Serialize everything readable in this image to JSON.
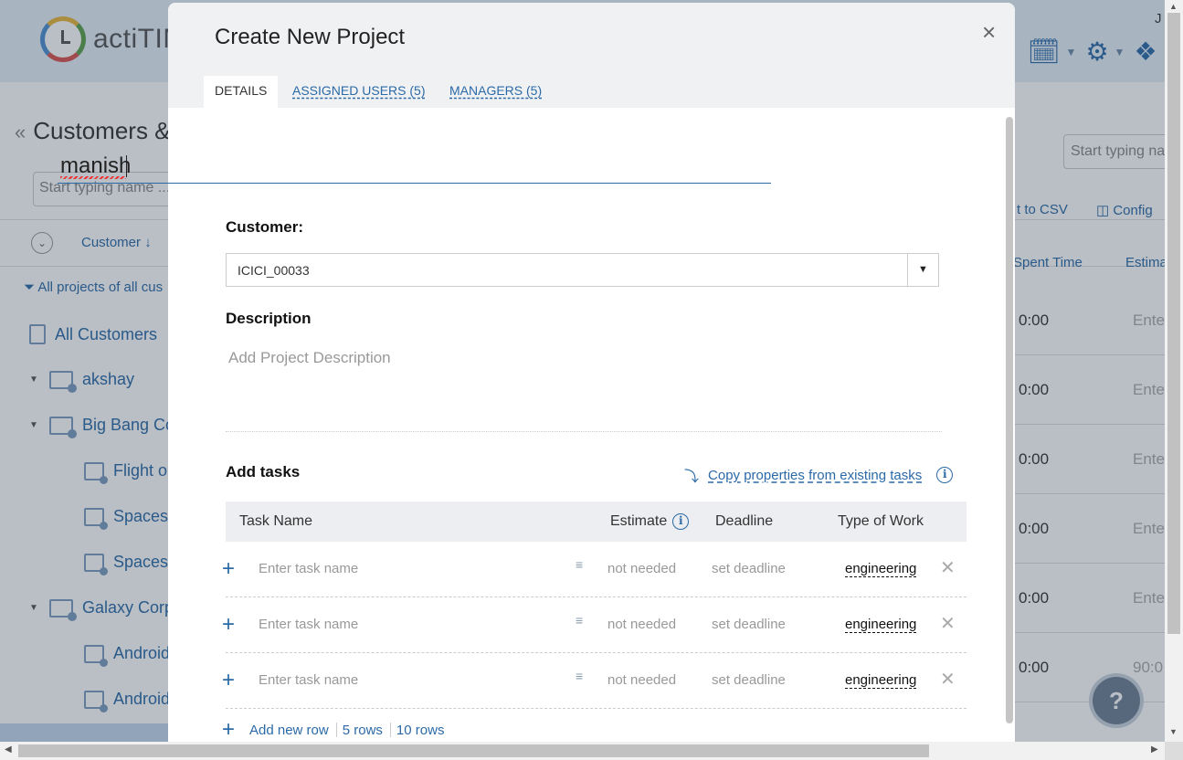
{
  "background": {
    "app_name": "actiTIM",
    "user_initial": "J",
    "page_title": "Customers &",
    "left_search_placeholder": "Start typing name ...",
    "right_search_placeholder": "Start typing na",
    "customer_column": "Customer",
    "filter_text": "All projects of all cus",
    "tree": [
      {
        "label": "All Customers",
        "type": "all"
      },
      {
        "label": "akshay",
        "type": "customer"
      },
      {
        "label": "Big Bang Co",
        "type": "customer"
      },
      {
        "label": "Flight op",
        "type": "project"
      },
      {
        "label": "Spacesh",
        "type": "project"
      },
      {
        "label": "Spacesh",
        "type": "project"
      },
      {
        "label": "Galaxy Corp",
        "type": "customer"
      },
      {
        "label": "Android",
        "type": "project"
      },
      {
        "label": "Android",
        "type": "project"
      }
    ],
    "toolbar": {
      "export": "t to CSV",
      "configure": "Config"
    },
    "columns": {
      "spent_time": "Spent Time",
      "estimate": "Estima"
    },
    "rows": [
      {
        "time": "0:00",
        "estimate": "Ente"
      },
      {
        "time": "0:00",
        "estimate": "Ente"
      },
      {
        "time": "0:00",
        "estimate": "Ente"
      },
      {
        "time": "0:00",
        "estimate": "Ente"
      },
      {
        "time": "0:00",
        "estimate": "Ente"
      },
      {
        "time": "0:00",
        "estimate": "90:0"
      }
    ],
    "help": "?"
  },
  "modal": {
    "title": "Create New Project",
    "close": "×",
    "tabs": {
      "details": "DETAILS",
      "assigned_users": "ASSIGNED USERS (5)",
      "managers": "MANAGERS (5)"
    },
    "project_name": "manish",
    "customer_label": "Customer:",
    "customer_value": "ICICI_00033",
    "description_label": "Description",
    "description_placeholder": "Add Project Description",
    "add_tasks_label": "Add tasks",
    "copy_properties": "Copy properties from existing tasks",
    "table_headers": {
      "task_name": "Task Name",
      "estimate": "Estimate",
      "deadline": "Deadline",
      "type_of_work": "Type of Work"
    },
    "tasks": [
      {
        "placeholder": "Enter task name",
        "estimate": "not needed",
        "deadline": "set deadline",
        "type_of_work": "engineering"
      },
      {
        "placeholder": "Enter task name",
        "estimate": "not needed",
        "deadline": "set deadline",
        "type_of_work": "engineering"
      },
      {
        "placeholder": "Enter task name",
        "estimate": "not needed",
        "deadline": "set deadline",
        "type_of_work": "engineering"
      }
    ],
    "add_new_row": "Add new row",
    "five_rows": "5 rows",
    "ten_rows": "10 rows"
  },
  "colors": {
    "accent": "#2b6aa7",
    "header_bg": "#f0f1f3"
  }
}
